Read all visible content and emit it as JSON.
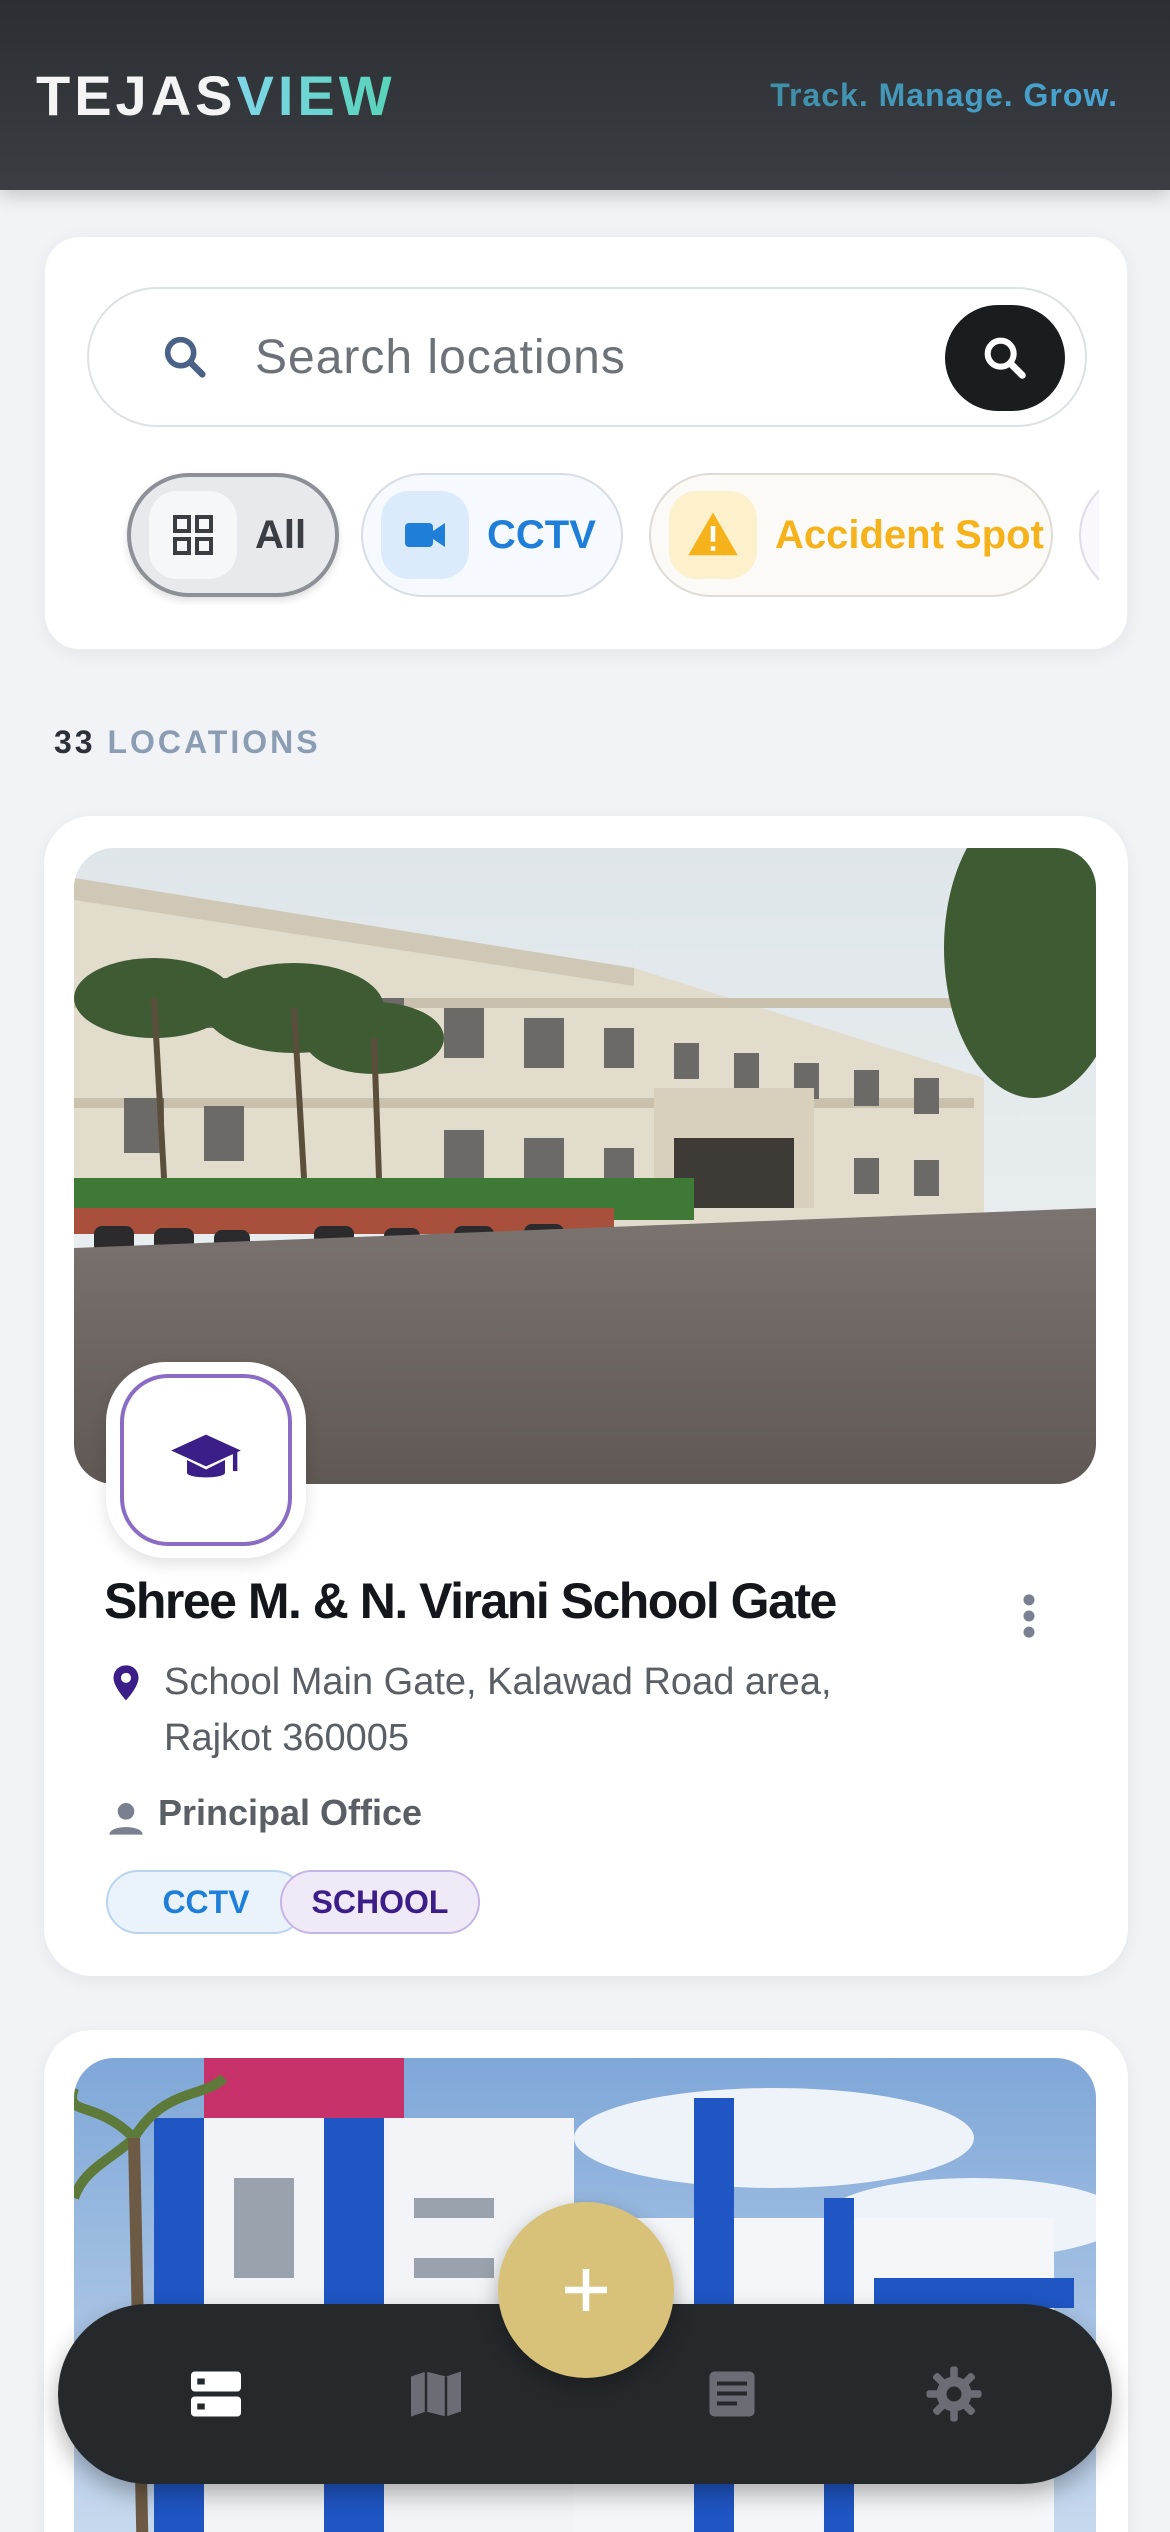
{
  "header": {
    "brand_part1": "TEJAS",
    "brand_part2": "VIEW",
    "tagline": "Track. Manage. Grow."
  },
  "search": {
    "placeholder": "Search locations"
  },
  "filters": [
    {
      "label": "All",
      "icon": "grid-icon",
      "selected": true
    },
    {
      "label": "CCTV",
      "icon": "video-camera-icon",
      "color": "#1f7fd8"
    },
    {
      "label": "Accident Spot",
      "icon": "warning-icon",
      "color": "#f5b21a"
    },
    {
      "label": "",
      "icon": "more-category-icon",
      "color": "#6b3bb8"
    }
  ],
  "results": {
    "count": "33",
    "label": "LOCATIONS"
  },
  "locations": [
    {
      "title": "Shree M. & N. Virani School Gate",
      "address": "School Main Gate, Kalawad Road area, Rajkot 360005",
      "owner": "Principal Office",
      "category_icon": "graduation-cap-icon",
      "tags": [
        "CCTV",
        "SCHOOL"
      ]
    }
  ],
  "nav": {
    "items": [
      "list-icon",
      "map-icon",
      "document-icon",
      "settings-icon"
    ],
    "active": "list-icon",
    "fab_icon": "plus-icon",
    "fab_color": "#d8c27a"
  },
  "colors": {
    "accent_blue": "#1f7fd8",
    "accent_yellow": "#f5b21a",
    "school_purple": "#3b1e87"
  }
}
